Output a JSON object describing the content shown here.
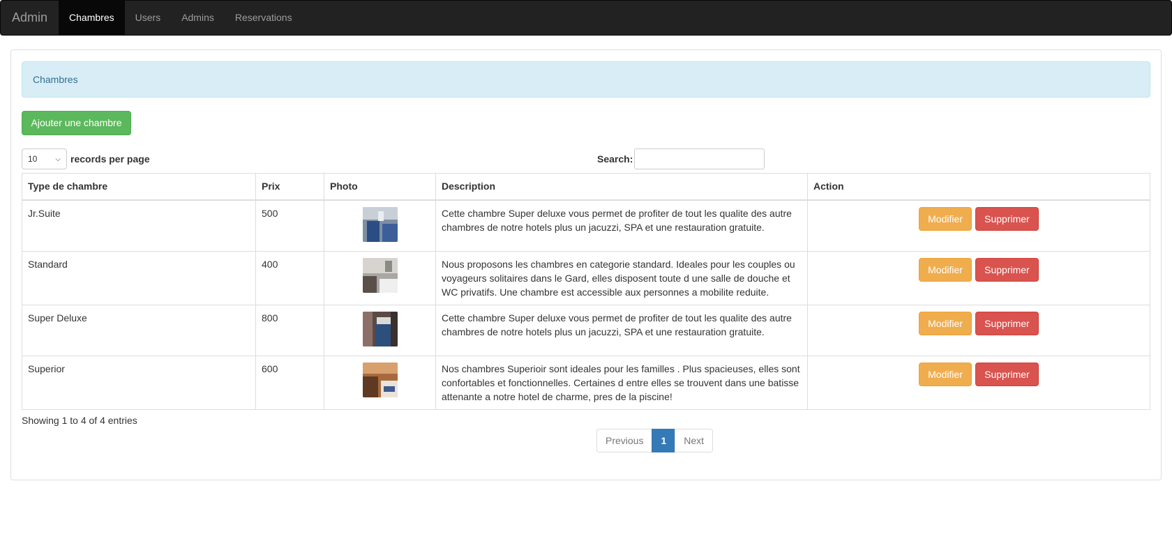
{
  "navbar": {
    "brand": "Admin",
    "items": [
      {
        "label": "Chambres",
        "active": true
      },
      {
        "label": "Users",
        "active": false
      },
      {
        "label": "Admins",
        "active": false
      },
      {
        "label": "Reservations",
        "active": false
      }
    ]
  },
  "alert": {
    "text": "Chambres"
  },
  "add_button": {
    "label": "Ajouter une chambre"
  },
  "length": {
    "value": "10",
    "label": "records per page"
  },
  "search": {
    "label": "Search:",
    "value": "",
    "placeholder": ""
  },
  "table": {
    "headers": [
      "Type de chambre",
      "Prix",
      "Photo",
      "Description",
      "Action"
    ],
    "rows": [
      {
        "type": "Jr.Suite",
        "prix": "500",
        "photo": "room-photo-blue-suite",
        "description": "Cette chambre Super deluxe vous permet de profiter de tout les qualite des autre chambres de notre hotels plus un jacuzzi, SPA et une restauration gratuite.",
        "modifier": "Modifier",
        "supprimer": "Supprimer"
      },
      {
        "type": "Standard",
        "prix": "400",
        "photo": "room-photo-grey-standard",
        "description": "Nous proposons les chambres en categorie standard. Ideales pour les couples ou voyageurs solitaires dans le Gard, elles disposent toute d une salle de douche et WC privatifs. Une chambre est accessible aux personnes a mobilite reduite.",
        "modifier": "Modifier",
        "supprimer": "Supprimer"
      },
      {
        "type": "Super Deluxe",
        "prix": "800",
        "photo": "room-photo-dark-deluxe",
        "description": "Cette chambre Super deluxe vous permet de profiter de tout les qualite des autre chambres de notre hotels plus un jacuzzi, SPA et une restauration gratuite.",
        "modifier": "Modifier",
        "supprimer": "Supprimer"
      },
      {
        "type": "Superior",
        "prix": "600",
        "photo": "room-photo-warm-superior",
        "description": "Nos chambres Superioir sont ideales pour les familles . Plus spacieuses, elles sont confortables et fonctionnelles. Certaines d entre elles se trouvent dans une batisse attenante a notre hotel de charme, pres de la piscine!",
        "modifier": "Modifier",
        "supprimer": "Supprimer"
      }
    ]
  },
  "info": "Showing 1 to 4 of 4 entries",
  "pagination": {
    "previous": "Previous",
    "current": "1",
    "next": "Next"
  },
  "colors": {
    "navbar_bg": "#222222",
    "alert_bg": "#d9edf7",
    "success": "#5cb85c",
    "warning": "#f0ad4e",
    "danger": "#d9534f",
    "primary": "#337ab7"
  }
}
